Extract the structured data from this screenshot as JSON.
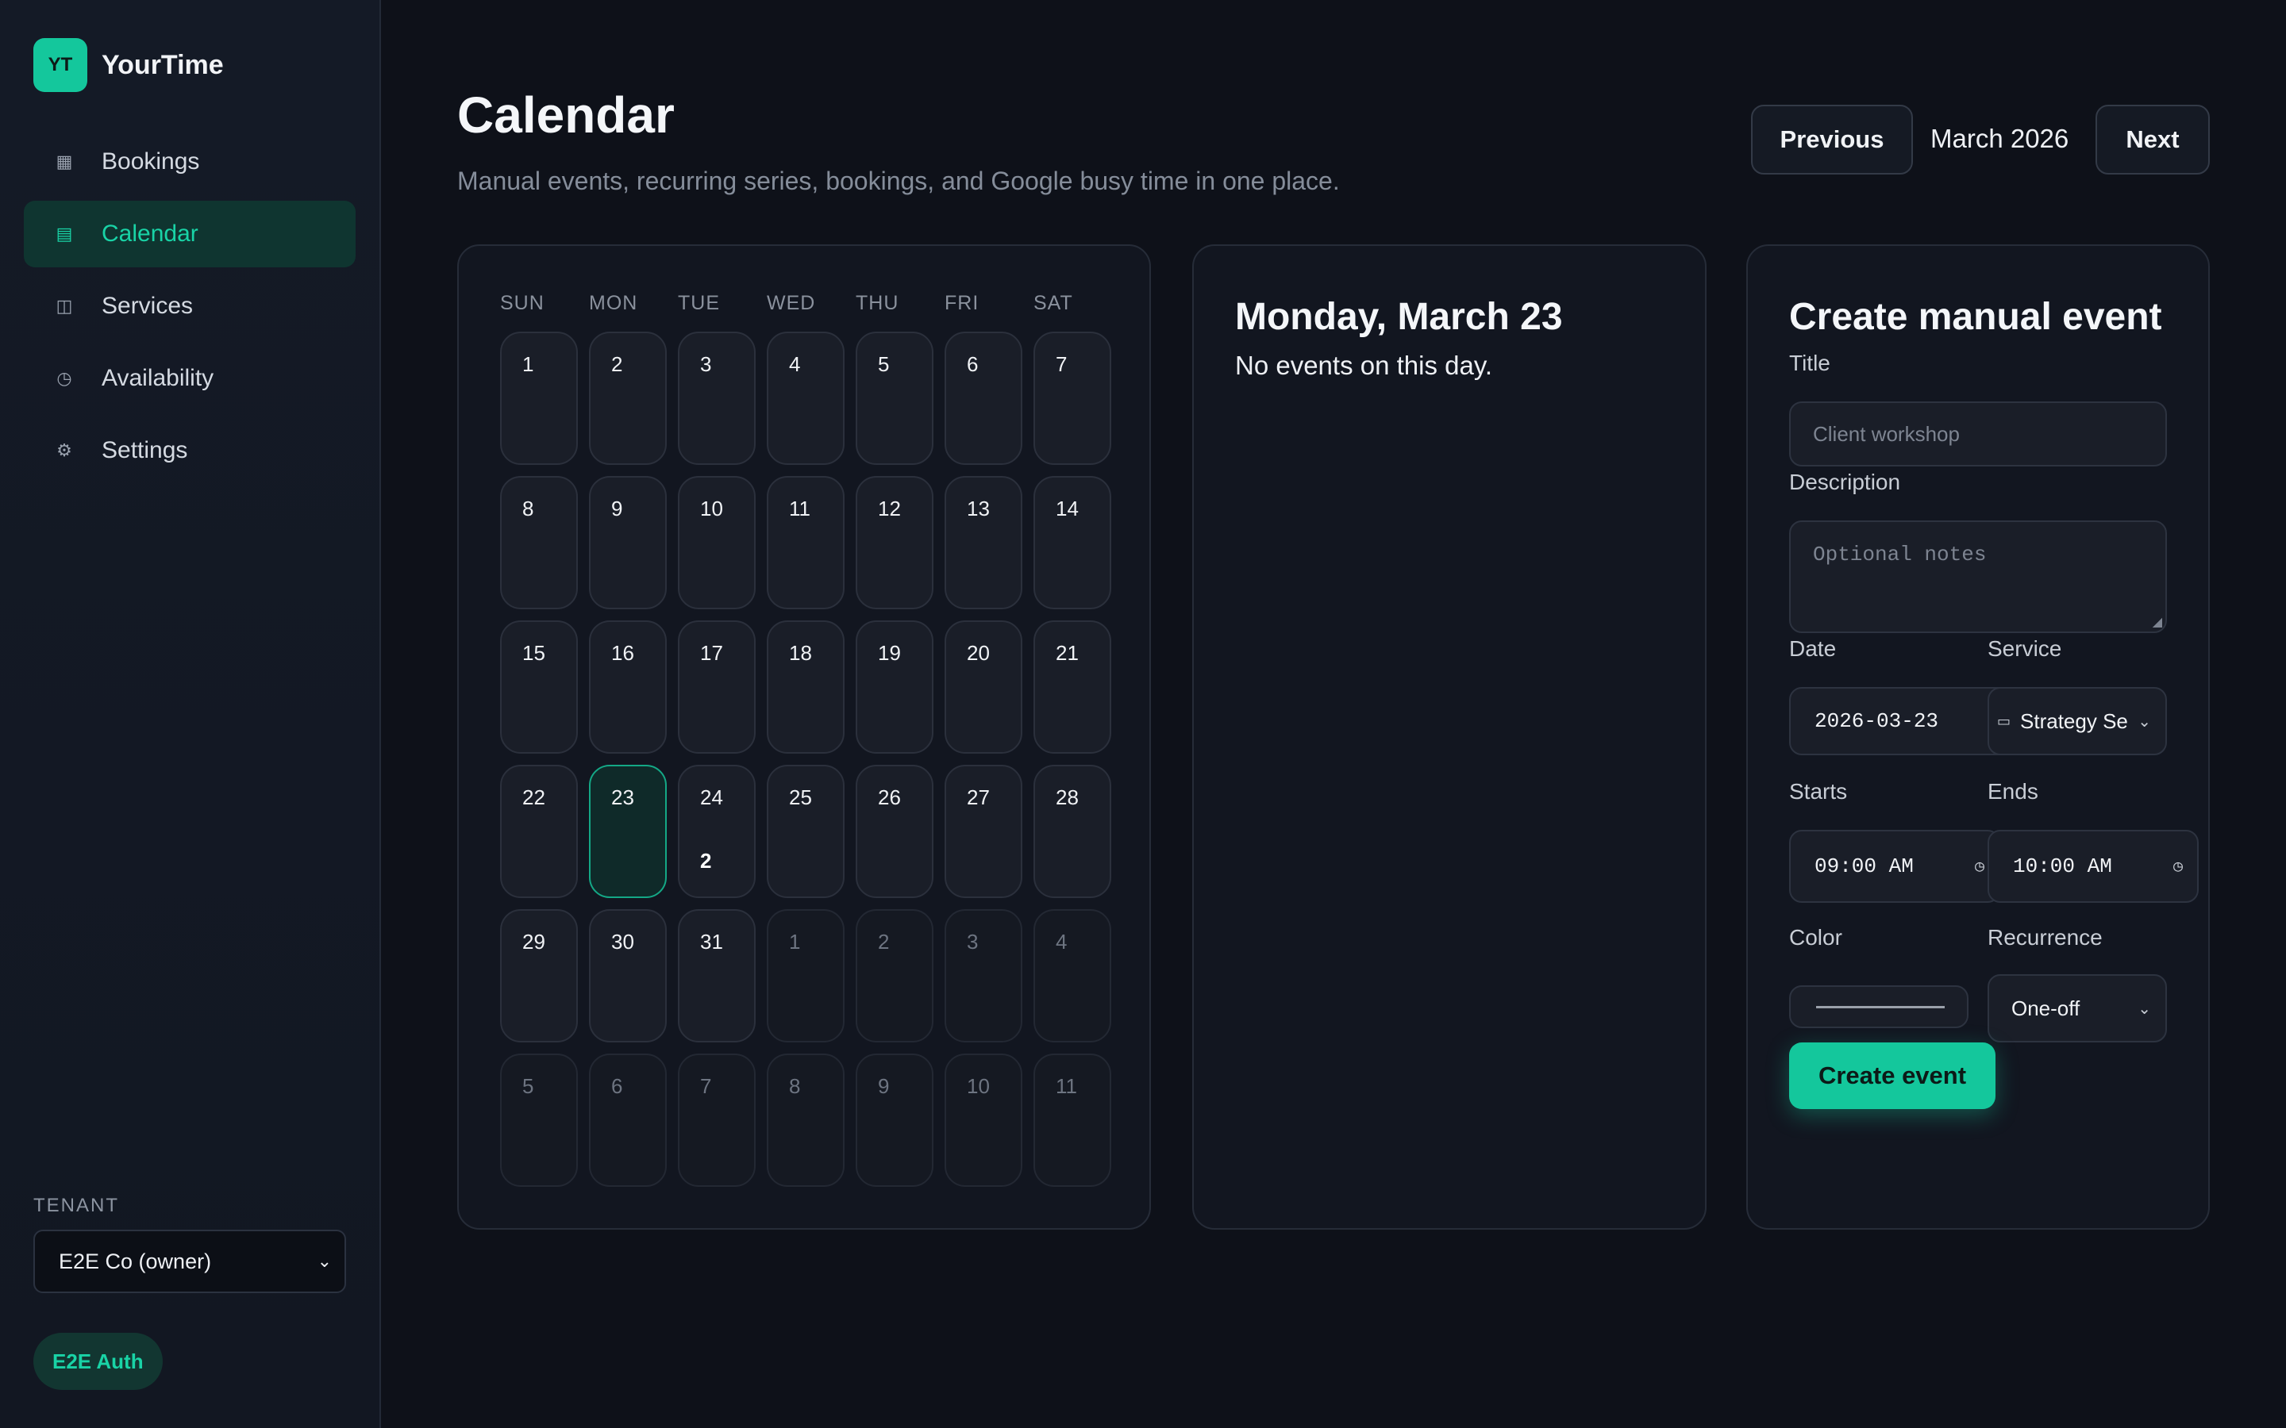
{
  "brand": {
    "logo": "YT",
    "name": "YourTime"
  },
  "nav": [
    {
      "label": "Bookings",
      "icon": "grid-icon",
      "glyph": "▦",
      "active": false
    },
    {
      "label": "Calendar",
      "icon": "calendar-icon",
      "glyph": "▤",
      "active": true
    },
    {
      "label": "Services",
      "icon": "services-icon",
      "glyph": "◫",
      "active": false
    },
    {
      "label": "Availability",
      "icon": "clock-icon",
      "glyph": "◷",
      "active": false
    },
    {
      "label": "Settings",
      "icon": "gear-icon",
      "glyph": "⚙",
      "active": false
    }
  ],
  "tenant": {
    "label": "TENANT",
    "value": "E2E Co (owner)"
  },
  "auth_badge": "E2E Auth",
  "header": {
    "title": "Calendar",
    "subtitle": "Manual events, recurring series, bookings, and Google busy time in one place.",
    "prev_label": "Previous",
    "month": "March 2026",
    "next_label": "Next"
  },
  "calendar": {
    "weekdays": [
      "SUN",
      "MON",
      "TUE",
      "WED",
      "THU",
      "FRI",
      "SAT"
    ],
    "selected_day": 23,
    "weeks": [
      [
        {
          "n": "1"
        },
        {
          "n": "2"
        },
        {
          "n": "3"
        },
        {
          "n": "4"
        },
        {
          "n": "5"
        },
        {
          "n": "6"
        },
        {
          "n": "7"
        }
      ],
      [
        {
          "n": "8"
        },
        {
          "n": "9"
        },
        {
          "n": "10"
        },
        {
          "n": "11"
        },
        {
          "n": "12"
        },
        {
          "n": "13"
        },
        {
          "n": "14"
        }
      ],
      [
        {
          "n": "15"
        },
        {
          "n": "16"
        },
        {
          "n": "17"
        },
        {
          "n": "18"
        },
        {
          "n": "19"
        },
        {
          "n": "20"
        },
        {
          "n": "21"
        }
      ],
      [
        {
          "n": "22"
        },
        {
          "n": "23",
          "selected": true
        },
        {
          "n": "24",
          "count": "2"
        },
        {
          "n": "25"
        },
        {
          "n": "26"
        },
        {
          "n": "27"
        },
        {
          "n": "28"
        }
      ],
      [
        {
          "n": "29"
        },
        {
          "n": "30"
        },
        {
          "n": "31"
        },
        {
          "n": "1",
          "other": true
        },
        {
          "n": "2",
          "other": true
        },
        {
          "n": "3",
          "other": true
        },
        {
          "n": "4",
          "other": true
        }
      ],
      [
        {
          "n": "5",
          "other": true
        },
        {
          "n": "6",
          "other": true
        },
        {
          "n": "7",
          "other": true
        },
        {
          "n": "8",
          "other": true
        },
        {
          "n": "9",
          "other": true
        },
        {
          "n": "10",
          "other": true
        },
        {
          "n": "11",
          "other": true
        }
      ]
    ]
  },
  "day_panel": {
    "title": "Monday, March 23",
    "empty": "No events on this day."
  },
  "form": {
    "title": "Create manual event",
    "title_label": "Title",
    "title_placeholder": "Client workshop",
    "description_label": "Description",
    "description_placeholder": "Optional notes",
    "date_label": "Date",
    "date_value": "2026-03-23",
    "service_label": "Service",
    "service_value": "Strategy Se",
    "starts_label": "Starts",
    "starts_value": "09:00 AM",
    "ends_label": "Ends",
    "ends_value": "10:00 AM",
    "color_label": "Color",
    "recurrence_label": "Recurrence",
    "recurrence_value": "One-off",
    "submit_label": "Create event"
  },
  "colors": {
    "accent": "#14c79c",
    "background": "#0e1119",
    "panel": "#121620"
  }
}
